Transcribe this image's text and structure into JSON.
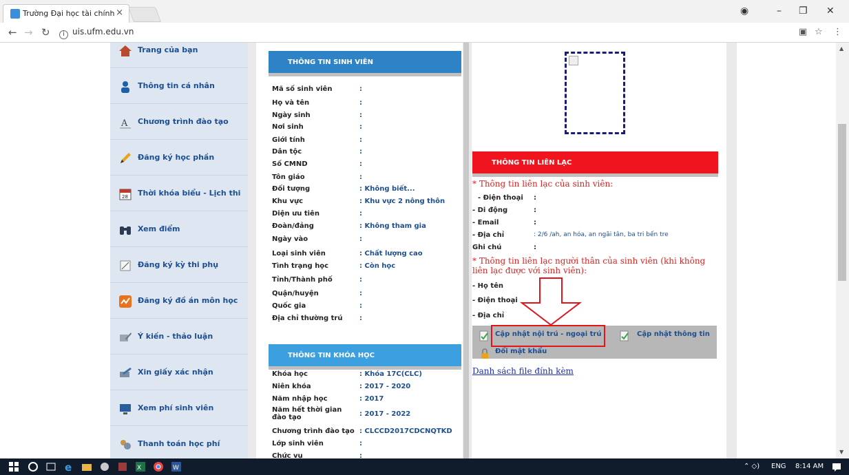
{
  "browser": {
    "tab_title": "Trường Đại học tài chính",
    "tab_close": "×",
    "url": "uis.ufm.edu.vn"
  },
  "sidebar": {
    "items": [
      {
        "label": "Trang của bạn",
        "icon": "home-icon"
      },
      {
        "label": "Thông tin cá nhân",
        "icon": "person-icon"
      },
      {
        "label": "Chương trình đào tạo",
        "icon": "curriculum-icon"
      },
      {
        "label": "Đăng ký học phần",
        "icon": "pencil-icon"
      },
      {
        "label": "Thời khóa biểu - Lịch thi",
        "icon": "calendar-icon"
      },
      {
        "label": "Xem điểm",
        "icon": "binoculars-icon"
      },
      {
        "label": "Đăng ký kỳ thi phụ",
        "icon": "exam-icon"
      },
      {
        "label": "Đăng ký đồ án môn học",
        "icon": "chart-icon"
      },
      {
        "label": "Ý kiến - thảo luận",
        "icon": "feedback-icon"
      },
      {
        "label": "Xin giấy xác nhận",
        "icon": "certificate-icon"
      },
      {
        "label": "Xem phí sinh viên",
        "icon": "monitor-icon"
      },
      {
        "label": "Thanh toán học phí",
        "icon": "payment-icon"
      }
    ]
  },
  "student_info": {
    "header": "THÔNG TIN SINH VIÊN",
    "rows": [
      {
        "label": "Mã số sinh viên",
        "value": ":"
      },
      {
        "label": "Họ và tên",
        "value": ":"
      },
      {
        "label": "Ngày sinh",
        "value": ":"
      },
      {
        "label": "Nơi sinh",
        "value": ":"
      },
      {
        "label": "Giới tính",
        "value": ":"
      },
      {
        "label": "Dân tộc",
        "value": ":"
      },
      {
        "label": "Số CMND",
        "value": ":"
      },
      {
        "label": "Tôn giáo",
        "value": ":"
      },
      {
        "label": "Đối tượng",
        "value": ": Không biết..."
      },
      {
        "label": "Khu vực",
        "value": ": Khu vực 2 nông thôn"
      },
      {
        "label": "Diện ưu tiên",
        "value": ":"
      },
      {
        "label": "Đoàn/đảng",
        "value": ": Không tham gia"
      },
      {
        "label": "Ngày vào",
        "value": ":"
      },
      {
        "label": "Loại sinh viên",
        "value": ": Chất lượng cao"
      },
      {
        "label": "Tình trạng học",
        "value": ": Còn học"
      },
      {
        "label": "Tỉnh/Thành phố",
        "value": ":"
      },
      {
        "label": "Quận/huyện",
        "value": ":"
      },
      {
        "label": "Quốc gia",
        "value": ":"
      },
      {
        "label": "Địa chỉ thường trú",
        "value": ":"
      }
    ]
  },
  "course_info": {
    "header": "THÔNG TIN KHÓA HỌC",
    "rows": [
      {
        "label": "Khóa học",
        "value": ": Khóa 17C(CLC)"
      },
      {
        "label": "Niên khóa",
        "value": ": 2017 - 2020"
      },
      {
        "label": "Năm nhập học",
        "value": ": 2017"
      },
      {
        "label": "Năm hết thời gian đào tạo",
        "value": ": 2017 - 2022"
      },
      {
        "label": "Chương trình đào tạo",
        "value": ": CLCCD2017CDCNQTKD"
      },
      {
        "label": "Lớp sinh viên",
        "value": ":"
      },
      {
        "label": "Chức vụ",
        "value": ":"
      }
    ]
  },
  "contact": {
    "header": "THÔNG TIN LIÊN LẠC",
    "student_title": "* Thông tin liên lạc của sinh viên:",
    "student_rows": [
      {
        "label": "- Điện thoại",
        "value": ":"
      },
      {
        "label": "- Di động",
        "value": ":"
      },
      {
        "label": "- Email",
        "value": ":"
      },
      {
        "label": "- Địa chỉ",
        "value": ": 2/6 /ah, an hóa, an ngãi tân, ba tri bến tre"
      },
      {
        "label": "Ghi chú",
        "value": ":"
      }
    ],
    "relative_title": "* Thông tin liên lạc người thân của sinh viên (khi không liên lạc được với sinh viên):",
    "relative_rows": [
      {
        "label": "- Họ tên"
      },
      {
        "label": "- Điện thoại"
      },
      {
        "label": "- Địa chỉ"
      }
    ],
    "actions": {
      "update_residence": "Cập nhật nội trú - ngoại trú",
      "update_info": "Cập nhật thông tin",
      "change_password": "Đổi mật khẩu"
    },
    "attachments_link": "Danh sách file đính kèm"
  },
  "taskbar": {
    "lang": "ENG",
    "time": "8:14 AM"
  }
}
